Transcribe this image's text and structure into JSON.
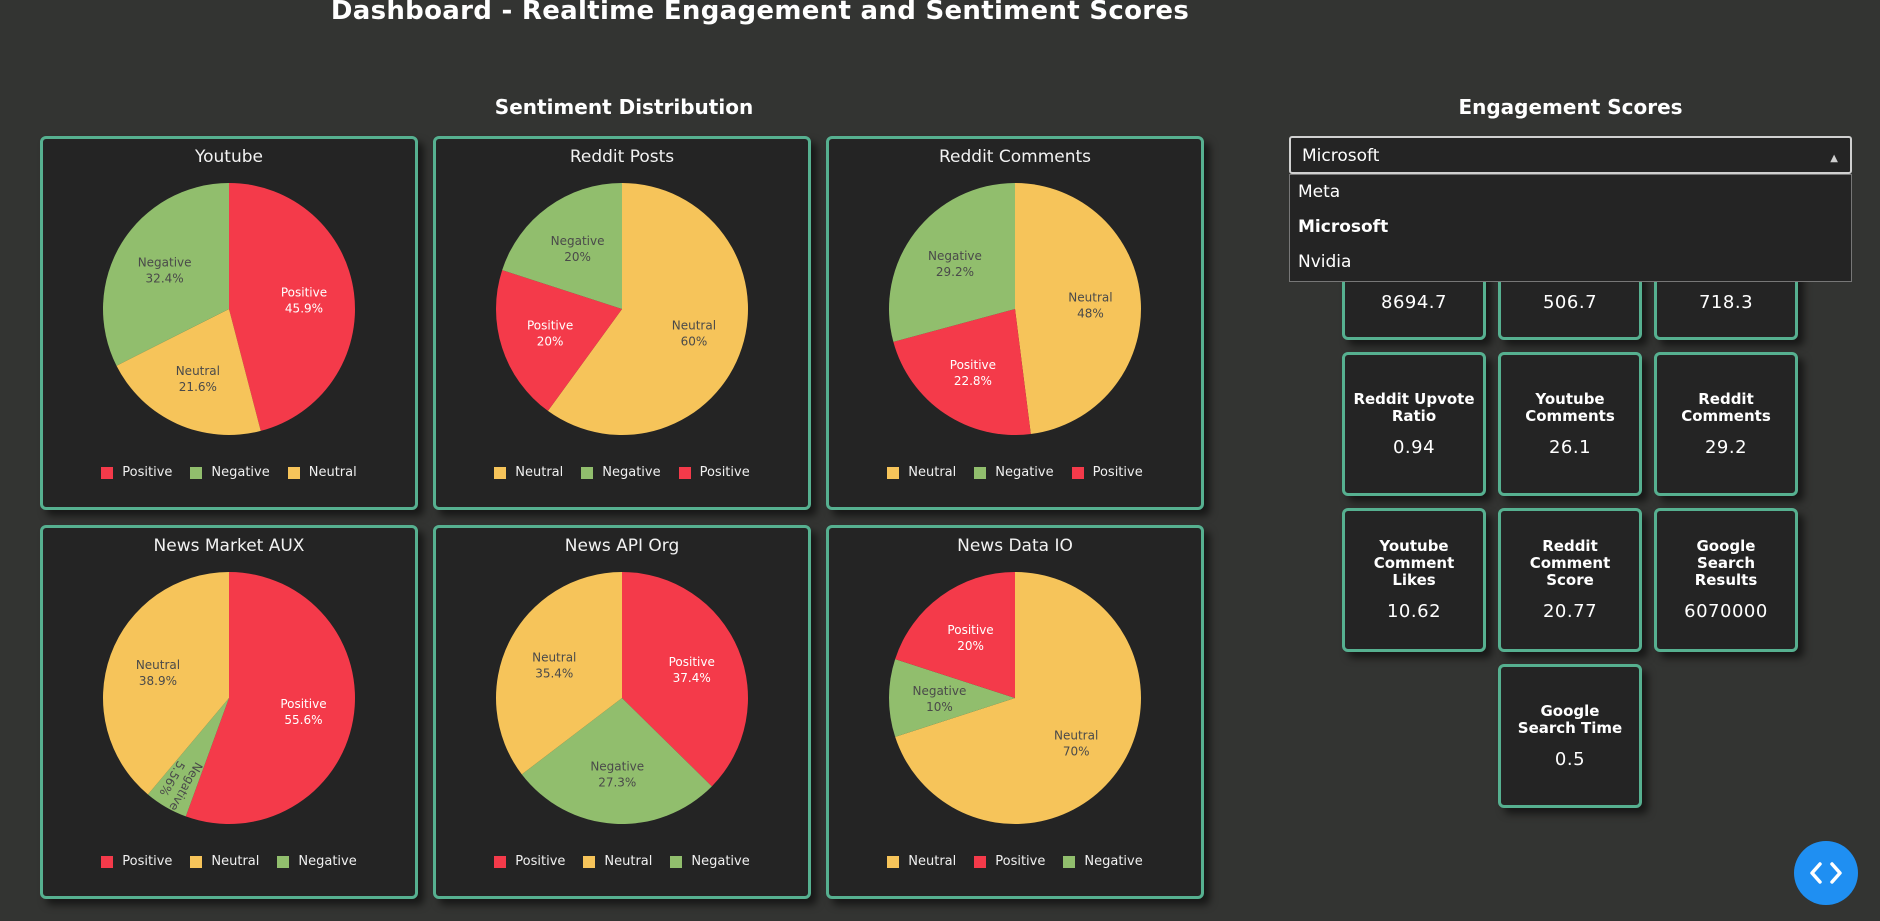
{
  "page_title": "Dashboard - Realtime Engagement and Sentiment Scores",
  "sections": {
    "sentiment": "Sentiment Distribution",
    "engagement": "Engagement Scores"
  },
  "colors": {
    "Positive": "#f43a4a",
    "Negative": "#91be6d",
    "Neutral": "#f6c45a",
    "border": "#56b090",
    "fab": "#1f8ff2"
  },
  "chart_data": [
    {
      "type": "pie",
      "title": "Youtube",
      "slices": [
        {
          "label": "Positive",
          "value": 45.9
        },
        {
          "label": "Neutral",
          "value": 21.6
        },
        {
          "label": "Negative",
          "value": 32.4
        }
      ],
      "legend": [
        "Positive",
        "Negative",
        "Neutral"
      ]
    },
    {
      "type": "pie",
      "title": "Reddit Posts",
      "slices": [
        {
          "label": "Neutral",
          "value": 60
        },
        {
          "label": "Positive",
          "value": 20
        },
        {
          "label": "Negative",
          "value": 20
        }
      ],
      "legend": [
        "Neutral",
        "Negative",
        "Positive"
      ]
    },
    {
      "type": "pie",
      "title": "Reddit Comments",
      "slices": [
        {
          "label": "Neutral",
          "value": 48
        },
        {
          "label": "Positive",
          "value": 22.8
        },
        {
          "label": "Negative",
          "value": 29.2
        }
      ],
      "legend": [
        "Neutral",
        "Negative",
        "Positive"
      ]
    },
    {
      "type": "pie",
      "title": "News Market AUX",
      "slices": [
        {
          "label": "Positive",
          "value": 55.6
        },
        {
          "label": "Negative",
          "value": 5.56
        },
        {
          "label": "Neutral",
          "value": 38.9
        }
      ],
      "legend": [
        "Positive",
        "Neutral",
        "Negative"
      ]
    },
    {
      "type": "pie",
      "title": "News API Org",
      "slices": [
        {
          "label": "Positive",
          "value": 37.4
        },
        {
          "label": "Negative",
          "value": 27.3
        },
        {
          "label": "Neutral",
          "value": 35.4
        }
      ],
      "legend": [
        "Positive",
        "Neutral",
        "Negative"
      ]
    },
    {
      "type": "pie",
      "title": "News Data IO",
      "slices": [
        {
          "label": "Neutral",
          "value": 70
        },
        {
          "label": "Negative",
          "value": 10
        },
        {
          "label": "Positive",
          "value": 20
        }
      ],
      "legend": [
        "Neutral",
        "Positive",
        "Negative"
      ]
    }
  ],
  "dropdown": {
    "selected": "Microsoft",
    "options": [
      "Meta",
      "Microsoft",
      "Nvidia"
    ]
  },
  "metrics": [
    {
      "label": "",
      "value": "8694.7"
    },
    {
      "label": "",
      "value": "506.7"
    },
    {
      "label": "",
      "value": "718.3"
    },
    {
      "label": "Reddit Upvote Ratio",
      "value": "0.94"
    },
    {
      "label": "Youtube Comments",
      "value": "26.1"
    },
    {
      "label": "Reddit Comments",
      "value": "29.2"
    },
    {
      "label": "Youtube Comment Likes",
      "value": "10.62"
    },
    {
      "label": "Reddit Comment Score",
      "value": "20.77"
    },
    {
      "label": "Google Search Results",
      "value": "6070000"
    },
    {
      "label": "Google Search Time",
      "value": "0.5"
    }
  ]
}
